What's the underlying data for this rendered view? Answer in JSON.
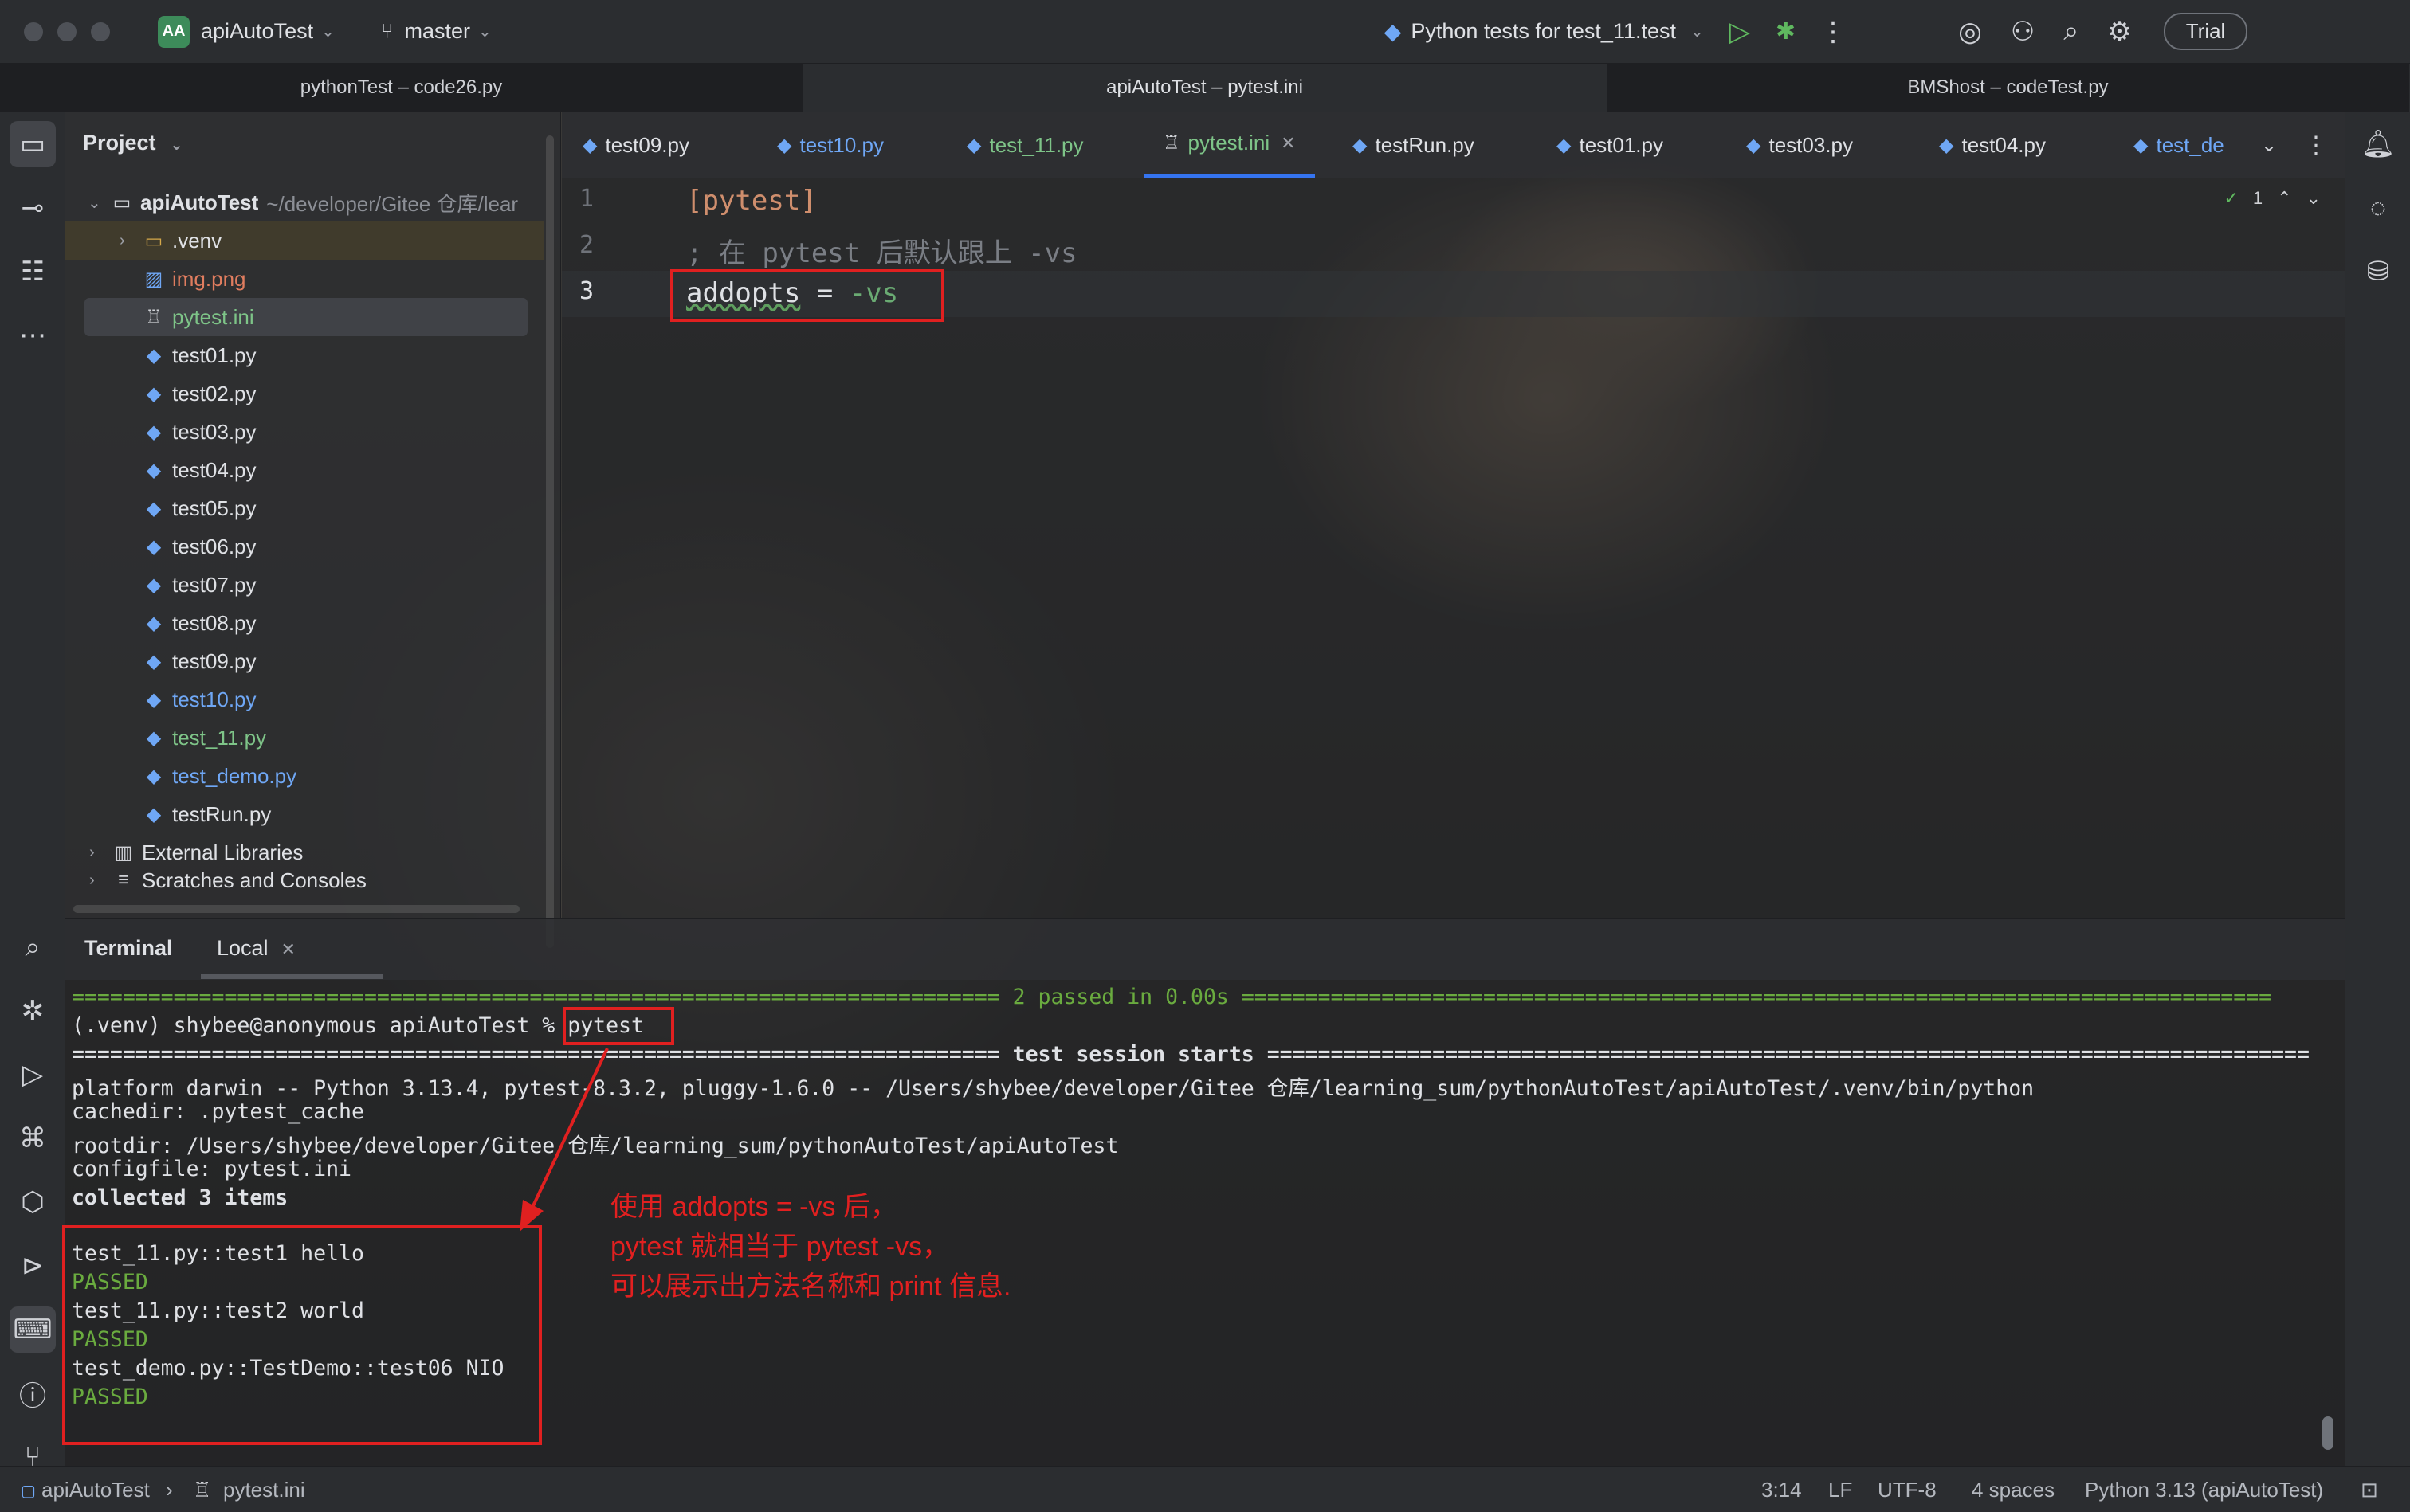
{
  "titlebar": {
    "project_badge": "AA",
    "project_name": "apiAutoTest",
    "branch": "master",
    "run_config": "Python tests for test_11.test",
    "trial_label": "Trial"
  },
  "window_tabs": [
    "pythonTest – code26.py",
    "apiAutoTest – pytest.ini",
    "BMShost – codeTest.py"
  ],
  "project_panel": {
    "title": "Project",
    "root_name": "apiAutoTest",
    "root_path": "~/developer/Gitee 仓库/lear",
    "items": [
      {
        "name": ".venv",
        "kind": "folder"
      },
      {
        "name": "img.png",
        "kind": "image"
      },
      {
        "name": "pytest.ini",
        "kind": "ini"
      },
      {
        "name": "test01.py",
        "kind": "py"
      },
      {
        "name": "test02.py",
        "kind": "py"
      },
      {
        "name": "test03.py",
        "kind": "py"
      },
      {
        "name": "test04.py",
        "kind": "py"
      },
      {
        "name": "test05.py",
        "kind": "py"
      },
      {
        "name": "test06.py",
        "kind": "py"
      },
      {
        "name": "test07.py",
        "kind": "py"
      },
      {
        "name": "test08.py",
        "kind": "py"
      },
      {
        "name": "test09.py",
        "kind": "py"
      },
      {
        "name": "test10.py",
        "kind": "py"
      },
      {
        "name": "test_11.py",
        "kind": "py"
      },
      {
        "name": "test_demo.py",
        "kind": "py"
      },
      {
        "name": "testRun.py",
        "kind": "py"
      }
    ],
    "external_libraries": "External Libraries",
    "scratches": "Scratches and Consoles"
  },
  "editor_tabs": [
    "test09.py",
    "test10.py",
    "test_11.py",
    "pytest.ini",
    "testRun.py",
    "test01.py",
    "test03.py",
    "test04.py",
    "test_de"
  ],
  "editor": {
    "line_numbers": [
      "1",
      "2",
      "3"
    ],
    "line1": "[pytest]",
    "line2": "; 在 pytest 后默认跟上 -vs",
    "line3_key": "addopts",
    "line3_eq": " = ",
    "line3_val": "-vs",
    "inspection_count": "1"
  },
  "terminal": {
    "title": "Terminal",
    "tab": "Local",
    "lines": {
      "l1_left": "=========================================================================",
      "l1_mid": " 2 passed in 0.00s ",
      "l1_right": "=================================================================================",
      "l2_prompt": "(.venv) shybee@anonymous apiAutoTest % ",
      "l2_cmd": "pytest",
      "l3": "========================================================================= test session starts ==================================================================================",
      "l4": "platform darwin -- Python 3.13.4, pytest-8.3.2, pluggy-1.6.0 -- /Users/shybee/developer/Gitee 仓库/learning_sum/pythonAutoTest/apiAutoTest/.venv/bin/python",
      "l5": "cachedir: .pytest_cache",
      "l6": "rootdir: /Users/shybee/developer/Gitee 仓库/learning_sum/pythonAutoTest/apiAutoTest",
      "l7": "configfile: pytest.ini",
      "l8": "collected 3 items",
      "l9": "test_11.py::test1 hello",
      "l10": "PASSED",
      "l11": "test_11.py::test2 world",
      "l12": "PASSED",
      "l13": "test_demo.py::TestDemo::test06 NIO",
      "l14": "PASSED"
    },
    "annotation": [
      "使用 addopts = -vs 后，",
      "pytest 就相当于 pytest -vs，",
      "可以展示出方法名称和 print 信息."
    ]
  },
  "statusbar": {
    "crumb1": "apiAutoTest",
    "crumb2": "pytest.ini",
    "position": "3:14",
    "line_sep": "LF",
    "encoding": "UTF-8",
    "indent": "4 spaces",
    "interpreter": "Python 3.13 (apiAutoTest)"
  }
}
